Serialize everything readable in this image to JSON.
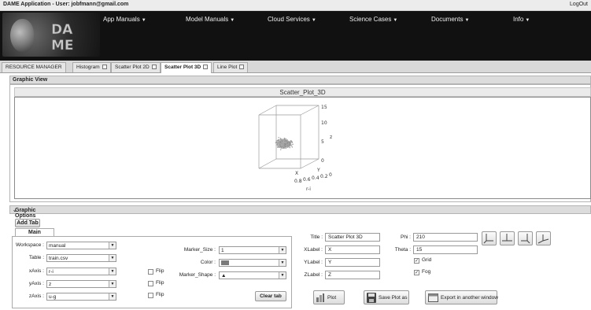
{
  "app": {
    "title": "DAME Application - User: jobfmann@gmail.com",
    "logout": "LogOut"
  },
  "menus": [
    {
      "label": "App Manuals"
    },
    {
      "label": "Model Manuals"
    },
    {
      "label": "Cloud Services"
    },
    {
      "label": "Science Cases"
    },
    {
      "label": "Documents"
    },
    {
      "label": "Info"
    }
  ],
  "tabs": [
    {
      "label": "RESOURCE MANAGER"
    },
    {
      "label": "Histogram"
    },
    {
      "label": "Scatter Plot 2D"
    },
    {
      "label": "Scatter Plot 3D"
    },
    {
      "label": "Line Plot"
    }
  ],
  "graphic_view": {
    "header": "Graphic View",
    "plot_title": "Scatter_Plot_3D",
    "axis_labels": {
      "z": "z",
      "x": "X",
      "y": "Y"
    },
    "vertical_ticks": [
      "0",
      "5",
      "10",
      "15"
    ],
    "bottom_ticks": [
      "0.8",
      "0.6",
      "0.4",
      "0.2",
      "0"
    ],
    "bottom_label": "r-i"
  },
  "graphic_options": {
    "header": "Graphic Options",
    "add_tab": "Add Tab",
    "main_tab": "Main",
    "workspace": {
      "label": "Workspace :",
      "value": "manual"
    },
    "table": {
      "label": "Table :",
      "value": "train.csv"
    },
    "xaxis": {
      "label": "xAxis :",
      "value": "r-i"
    },
    "yaxis": {
      "label": "yAxis :",
      "value": "z"
    },
    "zaxis": {
      "label": "zAxis :",
      "value": "u-g"
    },
    "flip_label": "Flip",
    "marker_size": {
      "label": "Marker_Size :",
      "value": "1"
    },
    "color": {
      "label": "Color :",
      "swatch": "#7a7a7a"
    },
    "marker_shape": {
      "label": "Marker_Shape :",
      "value": "▲"
    },
    "clear_tab": "Clear tab",
    "title": {
      "label": "Title :",
      "value": "Scatter Plot 3D"
    },
    "xlabel": {
      "label": "XLabel :",
      "value": "X"
    },
    "ylabel": {
      "label": "YLabel :",
      "value": "Y"
    },
    "zlabel": {
      "label": "ZLabel :",
      "value": "Z"
    },
    "phi": {
      "label": "Phi :",
      "value": "210"
    },
    "theta": {
      "label": "Theta :",
      "value": "15"
    },
    "grid": {
      "label": "Grid",
      "checked": true
    },
    "fog": {
      "label": "Fog",
      "checked": true
    },
    "plot_button": "Plot",
    "save_button": "Save Plot as",
    "export_button": "Export in another window"
  },
  "colors": {
    "header_bg": "#111111",
    "tab_active": "#ffffff",
    "panel_header": "#dcdcdc"
  }
}
